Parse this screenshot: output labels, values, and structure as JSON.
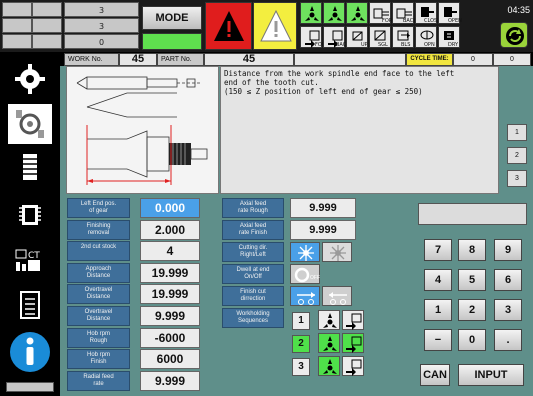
{
  "top": {
    "counters": [
      "3",
      "3",
      "0"
    ],
    "mode_label": "MODE",
    "clock": "04:35",
    "icon_captions": [
      "FOR",
      "BACK",
      "BACK",
      "UP",
      "SGL",
      "BLS",
      "OPN",
      "DRY",
      "CLOSE",
      "OPEN"
    ]
  },
  "header": {
    "work_no_label": "WORK No.",
    "work_no_value": "45",
    "part_no_label": "PART No.",
    "part_no_value": "45",
    "cycle_time_label": "CYCLE TIME:",
    "cycle_time_values": [
      "0",
      "0"
    ]
  },
  "description": {
    "lines": [
      "Distance from the work spindle end face to the left",
      "end of the tooth cut.",
      "(150 ≤ Z position of left end of gear ≤ 250)"
    ]
  },
  "page_buttons": [
    "1",
    "2",
    "3"
  ],
  "params_left": [
    {
      "label": "Left End pos.\nof gear",
      "value": "0.000"
    },
    {
      "label": "Finishing\nremoval",
      "value": "2.000"
    },
    {
      "label": "2nd cut stock",
      "value": "4"
    },
    {
      "label": "Approach\nDistance",
      "value": "19.999"
    },
    {
      "label": "Overtravel\nDistance",
      "value": "19.999"
    },
    {
      "label": "Overtravel\nDistance",
      "value": "9.999"
    },
    {
      "label": "Hob rpm\nRough",
      "value": "-6000"
    },
    {
      "label": "Hob rpm\nFinish",
      "value": "6000"
    },
    {
      "label": "Radial feed\nrate",
      "value": "9.999"
    }
  ],
  "params_right": [
    {
      "label": "Axial feed\nrate Rough",
      "value": "9.999"
    },
    {
      "label": "Axial feed\nrate Finish",
      "value": "9.999"
    },
    {
      "label": "Cutting dir.\nRight/Left"
    },
    {
      "label": "Dwell at end\nOn/Off",
      "toggle_text": "OFF"
    },
    {
      "label": "Finish cut\ndirrection"
    },
    {
      "label": "Workholding\nSequences"
    }
  ],
  "sequences": [
    "1",
    "2",
    "3"
  ],
  "keypad": {
    "keys": [
      "7",
      "8",
      "9",
      "4",
      "5",
      "6",
      "1",
      "2",
      "3",
      "−",
      "0",
      "."
    ],
    "can_label": "CAN",
    "input_label": "INPUT"
  },
  "colors": {
    "accent_blue": "#3f6f9a",
    "selected_field": "#4aa0e8",
    "panel_teal": "#5f8f8a",
    "active_green": "#4fe04a",
    "cycle_yellow": "#f1e640"
  }
}
